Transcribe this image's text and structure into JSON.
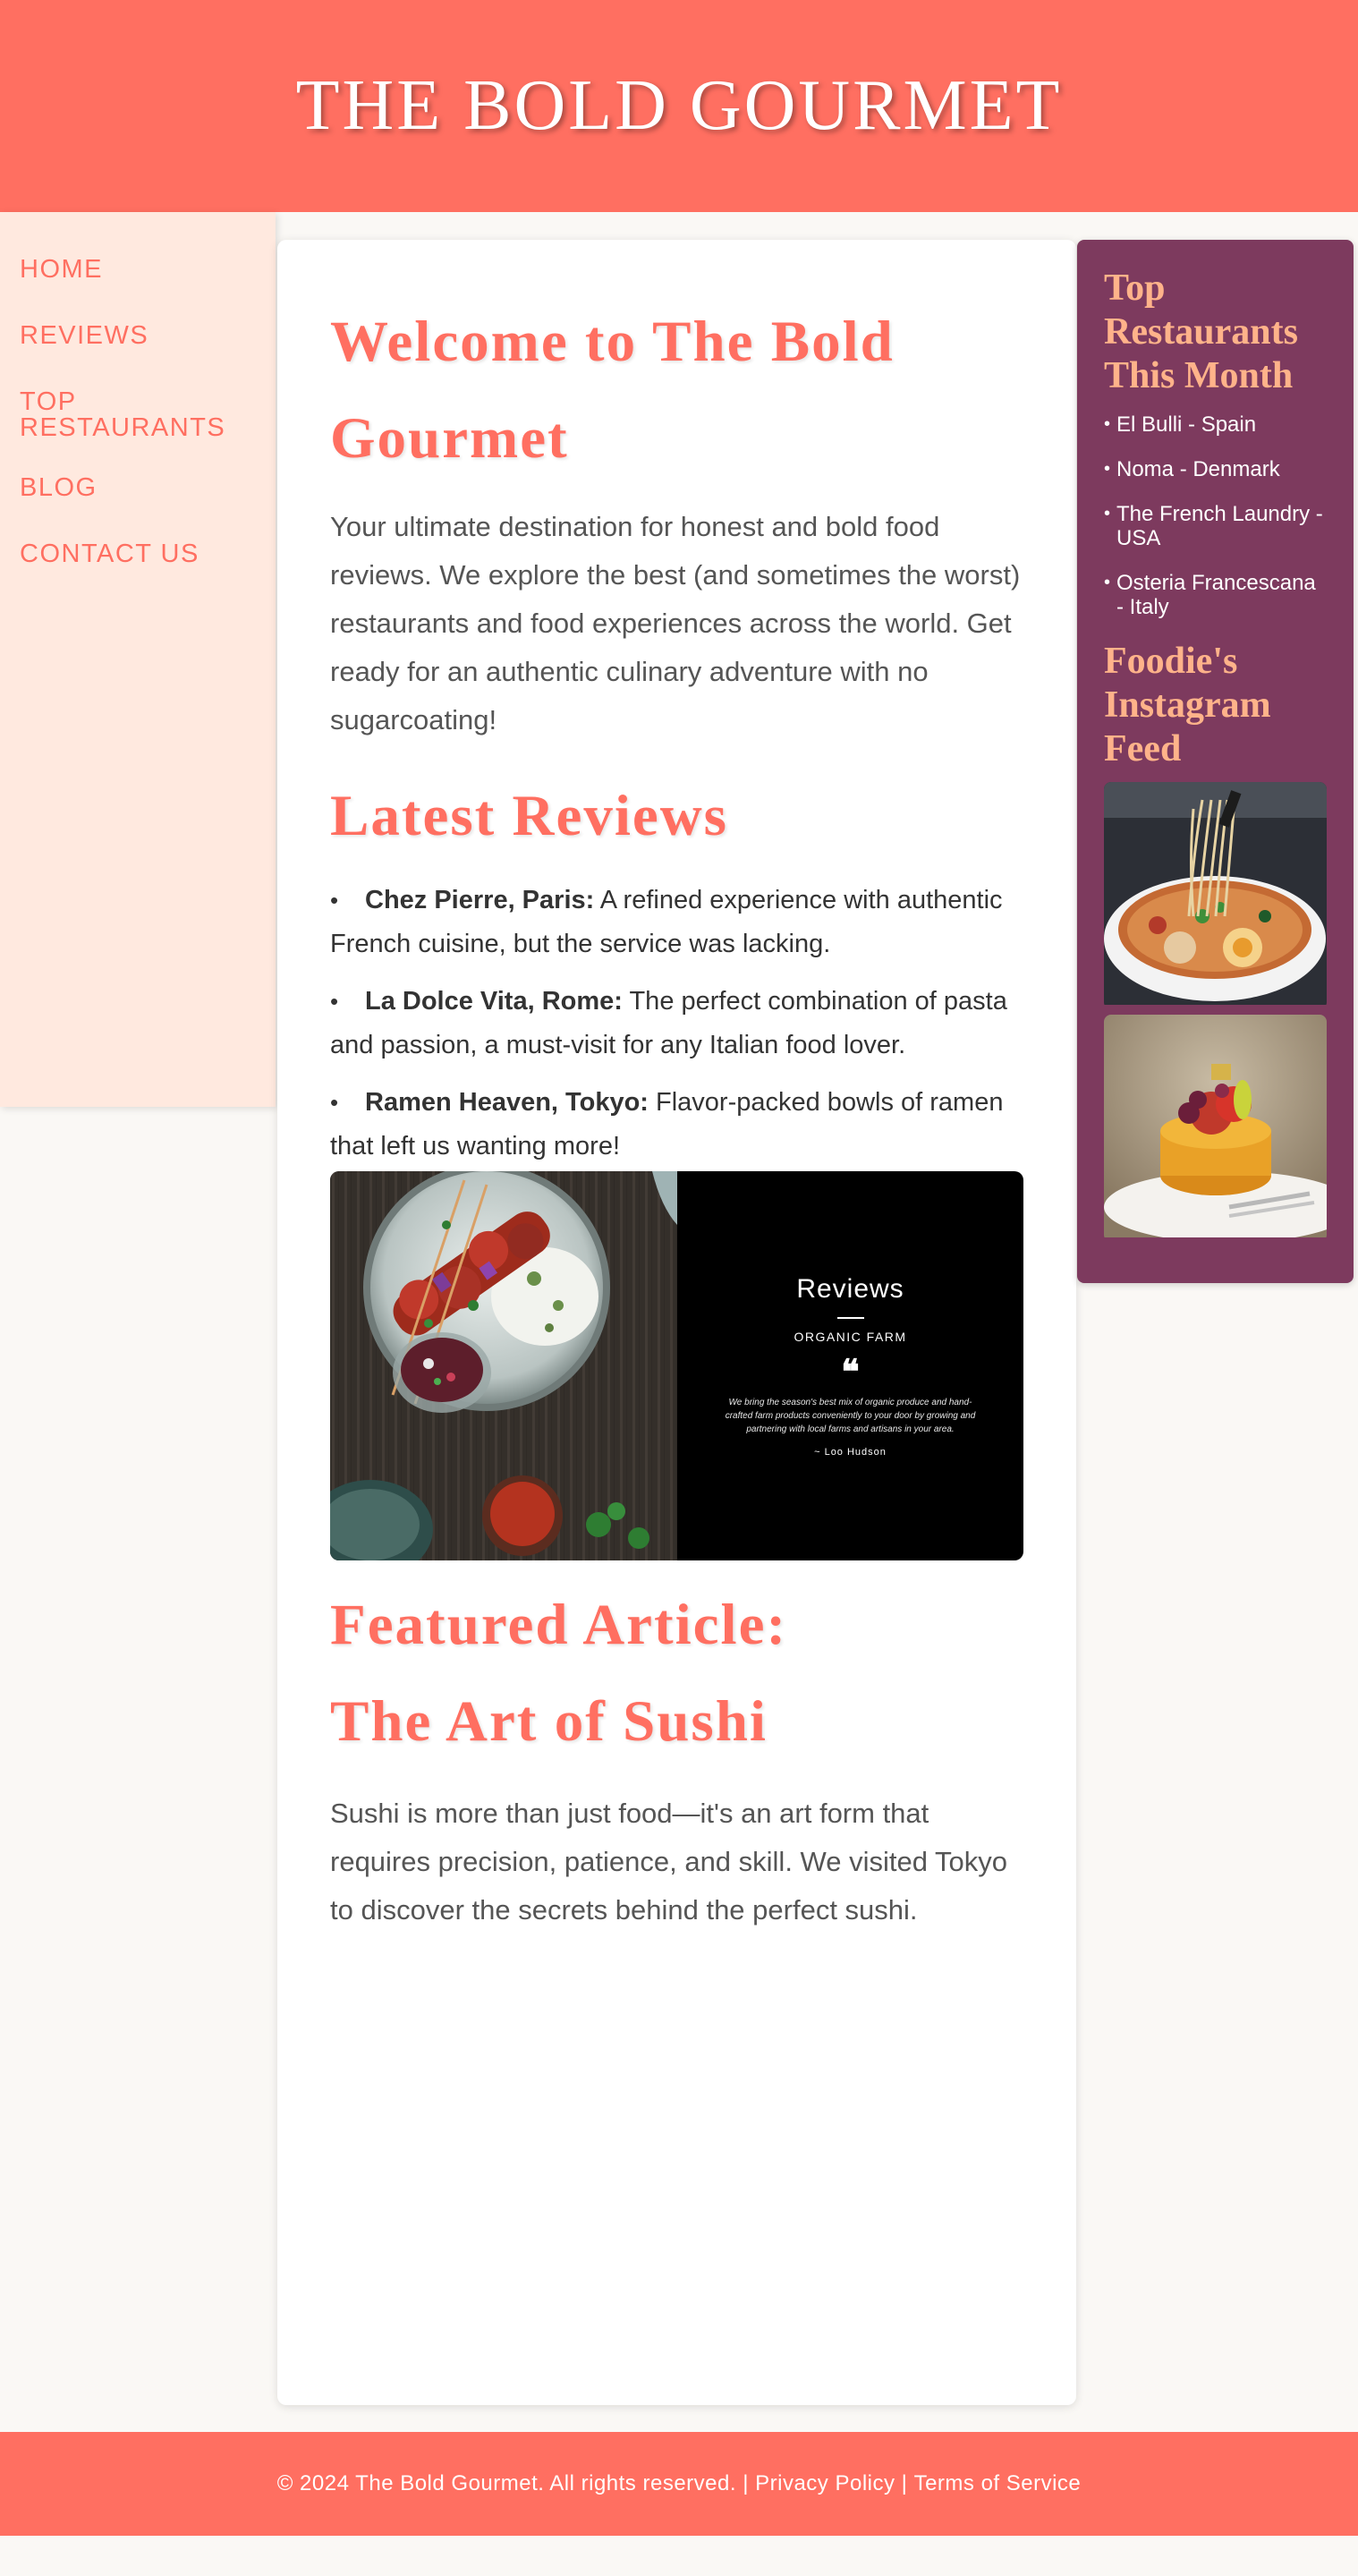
{
  "header": {
    "title": "THE BOLD GOURMET"
  },
  "nav": {
    "items": [
      {
        "label": "HOME"
      },
      {
        "label": "REVIEWS"
      },
      {
        "label": "TOP RESTAURANTS"
      },
      {
        "label": "BLOG"
      },
      {
        "label": "CONTACT US"
      }
    ]
  },
  "main": {
    "welcome_heading": "Welcome to The Bold Gourmet",
    "intro": "Your ultimate destination for honest and bold food reviews. We explore the best (and sometimes the worst) restaurants and food experiences across the world. Get ready for an authentic culinary adventure with no sugarcoating!",
    "latest_heading": "Latest Reviews",
    "reviews": [
      {
        "name": "Chez Pierre, Paris:",
        "text": " A refined experience with authentic French cuisine, but the service was lacking."
      },
      {
        "name": "La Dolce Vita, Rome:",
        "text": " The perfect combination of pasta and passion, a must-visit for any Italian food lover."
      },
      {
        "name": "Ramen Heaven, Tokyo:",
        "text": " Flavor-packed bowls of ramen that left us wanting more!"
      }
    ],
    "review_image": {
      "title": "Reviews",
      "subtitle": "ORGANIC FARM",
      "quote_mark": "❝",
      "quote": "We bring the season's best mix of organic produce and hand-crafted farm products conveniently to your door by growing and partnering with local farms and artisans in your area.",
      "author": "~ Loo Hudson"
    },
    "featured_heading_1": "Featured Article:",
    "featured_heading_2": "The Art of Sushi",
    "featured_text": "Sushi is more than just food—it's an art form that requires precision, patience, and skill. We visited Tokyo to discover the secrets behind the perfect sushi."
  },
  "sidebar": {
    "top_heading": "Top Restaurants This Month",
    "top_restaurants": [
      "El Bulli - Spain",
      "Noma - Denmark",
      "The French Laundry - USA",
      "Osteria Francescana - Italy"
    ],
    "instagram_heading": "Foodie's Instagram Feed"
  },
  "footer": {
    "copyright": "© 2024 The Bold Gourmet. All rights reserved.",
    "separator": " | ",
    "privacy": "Privacy Policy",
    "terms": "Terms of Service"
  },
  "colors": {
    "accent": "#ff6f61",
    "sidebar_purple": "#7d3a5e",
    "sidebar_heading": "#ffb38a",
    "nav_bg": "#ffe9df"
  }
}
